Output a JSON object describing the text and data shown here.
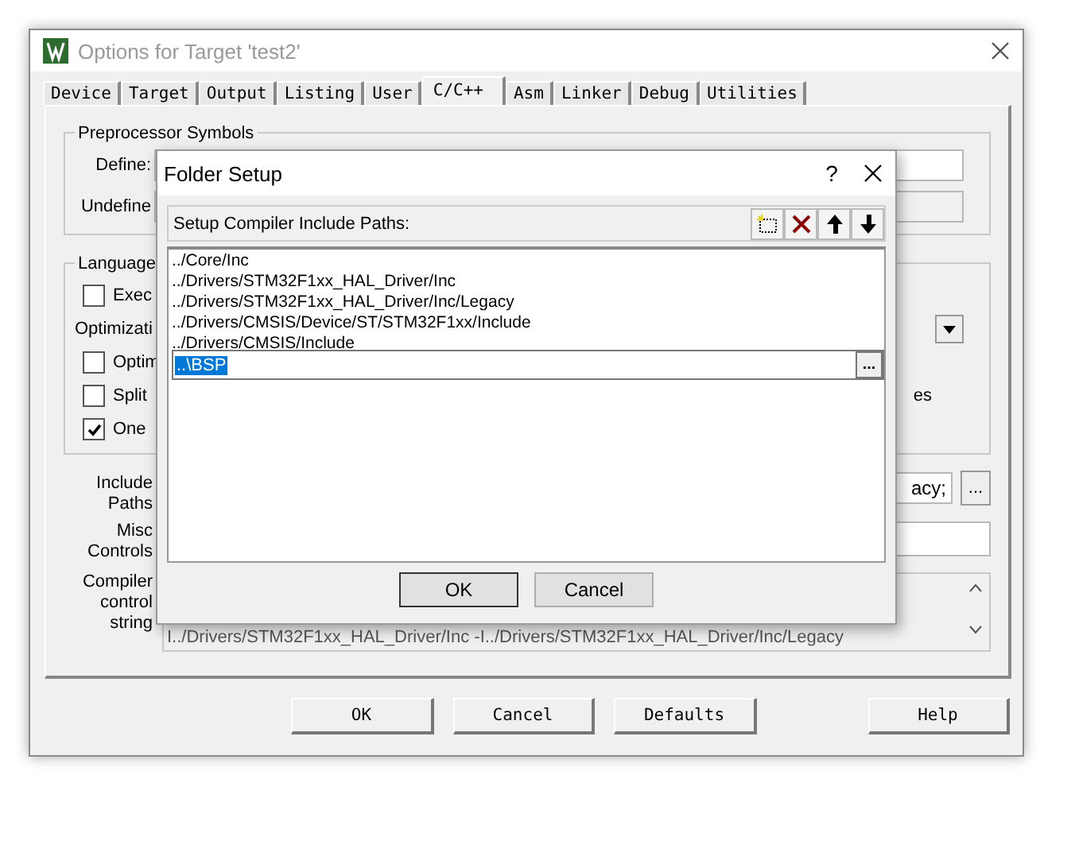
{
  "window": {
    "title": "Options for Target 'test2'"
  },
  "tabs": [
    {
      "label": "Device",
      "selected": false
    },
    {
      "label": "Target",
      "selected": false
    },
    {
      "label": "Output",
      "selected": false
    },
    {
      "label": "Listing",
      "selected": false
    },
    {
      "label": "User",
      "selected": false
    },
    {
      "label": "C/C++",
      "selected": true
    },
    {
      "label": "Asm",
      "selected": false
    },
    {
      "label": "Linker",
      "selected": false
    },
    {
      "label": "Debug",
      "selected": false
    },
    {
      "label": "Utilities",
      "selected": false
    }
  ],
  "preprocessor": {
    "title": "Preprocessor Symbols",
    "define_label": "Define:",
    "undefine_label": "Undefine"
  },
  "language": {
    "title": "Language",
    "options": [
      {
        "kind": "checkbox",
        "label": "Exec",
        "checked": false
      },
      {
        "kind": "dropdown",
        "label": "Optimizati"
      },
      {
        "kind": "checkbox",
        "label": "Optim",
        "checked": false
      },
      {
        "kind": "checkbox",
        "label": "Split",
        "checked": false,
        "right_label": "es"
      },
      {
        "kind": "checkbox",
        "label": "One",
        "checked": true
      }
    ]
  },
  "include_paths": {
    "label": "Include Paths",
    "value": "acy;",
    "browse": "..."
  },
  "misc_controls": {
    "label": "Misc Controls"
  },
  "compiler_string": {
    "label": "Compiler control string",
    "value": "I../Drivers/STM32F1xx_HAL_Driver/Inc -I../Drivers/STM32F1xx_HAL_Driver/Inc/Legacy"
  },
  "buttons": [
    "OK",
    "Cancel",
    "Defaults",
    "Help"
  ],
  "folder_setup": {
    "title": "Folder Setup",
    "help": "?",
    "header": "Setup Compiler Include Paths:",
    "paths": [
      "../Core/Inc",
      "../Drivers/STM32F1xx_HAL_Driver/Inc",
      "../Drivers/STM32F1xx_HAL_Driver/Inc/Legacy",
      "../Drivers/CMSIS/Device/ST/STM32F1xx/Include",
      "../Drivers/CMSIS/Include"
    ],
    "editing": {
      "value": "..\\BSP",
      "browse": "..."
    },
    "buttons": [
      "OK",
      "Cancel"
    ]
  }
}
